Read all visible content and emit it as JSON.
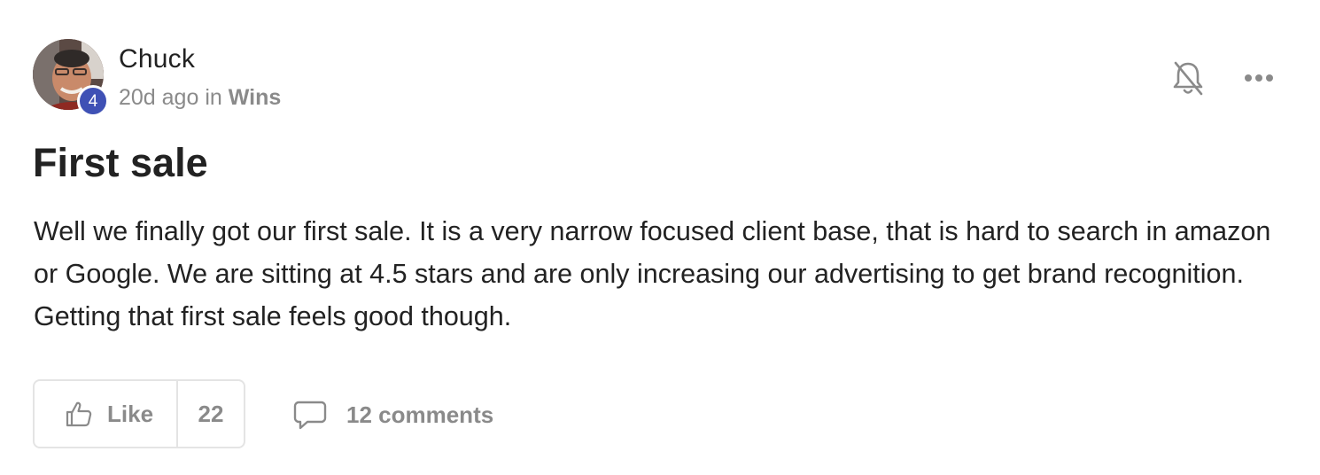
{
  "post": {
    "author": {
      "name": "Chuck",
      "level": "4",
      "avatar_icon": "user-photo-avatar"
    },
    "meta": {
      "time": "20d ago",
      "in_text": "in",
      "category": "Wins"
    },
    "actions": {
      "notification_icon": "bell-off-icon",
      "more_icon": "more-horizontal-icon"
    },
    "title": "First sale",
    "body": "Well we finally got our first sale. It is a very narrow focused client base, that is hard to search in amazon or Google. We are sitting at 4.5 stars and are only increasing our advertising to get brand recognition. Getting that first sale feels good though.",
    "like": {
      "label": "Like",
      "count": "22",
      "icon": "thumbs-up-icon"
    },
    "comments": {
      "label": "12 comments",
      "icon": "comment-bubble-icon"
    }
  },
  "colors": {
    "badge": "#3f51b5",
    "muted_text": "#8a8a8a",
    "primary_text": "#222222",
    "border": "#e4e4e4"
  }
}
